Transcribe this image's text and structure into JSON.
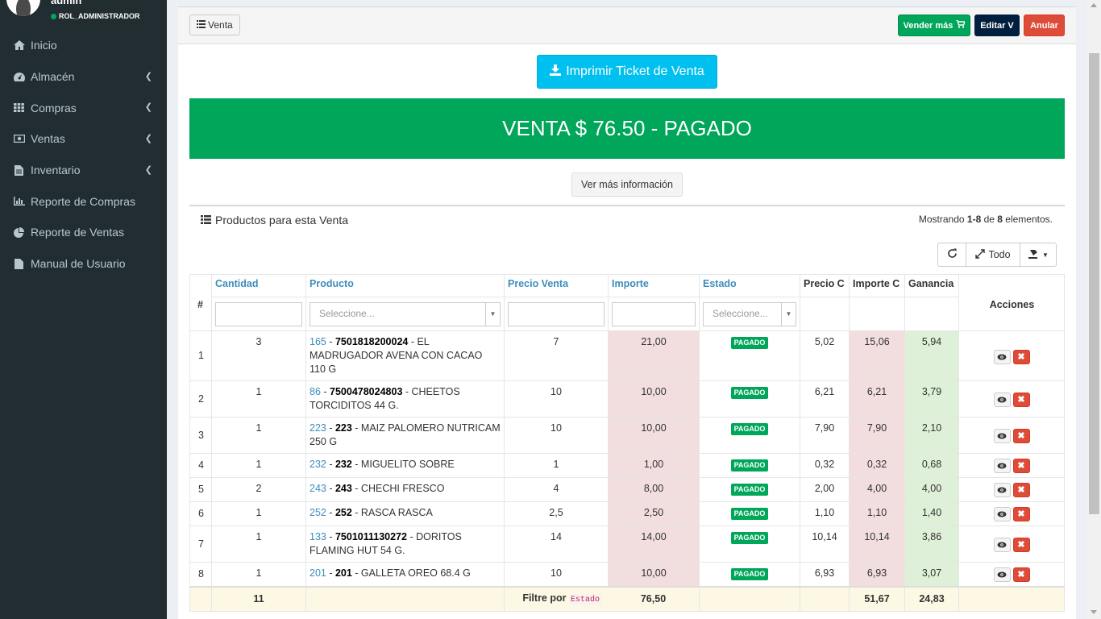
{
  "user": {
    "name": "admin",
    "role": "ROL_ADMINISTRADOR"
  },
  "sidebar": {
    "items": [
      {
        "label": "Inicio",
        "icon": "home-icon",
        "has_children": false
      },
      {
        "label": "Almacén",
        "icon": "dashboard-icon",
        "has_children": true
      },
      {
        "label": "Compras",
        "icon": "grid-icon",
        "has_children": true
      },
      {
        "label": "Ventas",
        "icon": "money-icon",
        "has_children": true
      },
      {
        "label": "Inventario",
        "icon": "file-icon",
        "has_children": true
      },
      {
        "label": "Reporte de Compras",
        "icon": "bar-chart-icon",
        "has_children": false
      },
      {
        "label": "Reporte de Ventas",
        "icon": "pie-chart-icon",
        "has_children": false
      },
      {
        "label": "Manual de Usuario",
        "icon": "file-icon",
        "has_children": false
      }
    ]
  },
  "header": {
    "venta_label": "Venta",
    "vender_label": "Vender más",
    "editar_label": "Editar V",
    "anular_label": "Anular"
  },
  "print_button": "Imprimir Ticket de Venta",
  "banner": "VENTA $ 76.50 - PAGADO",
  "more_info": "Ver más información",
  "products": {
    "title": "Productos para esta Venta",
    "summary": {
      "prefix": "Mostrando ",
      "range": "1-8",
      "mid": " de ",
      "total": "8",
      "suffix": " elementos."
    },
    "toolbar": {
      "all_label": "Todo"
    },
    "columns": {
      "idx": "#",
      "cantidad": "Cantidad",
      "producto": "Producto",
      "precio_venta": "Precio Venta",
      "importe": "Importe",
      "estado": "Estado",
      "precio_c": "Precio C",
      "importe_c": "Importe C",
      "ganancia": "Ganancia",
      "acciones": "Acciones"
    },
    "filters": {
      "select_placeholder": "Seleccione..."
    },
    "rows": [
      {
        "idx": "1",
        "cantidad": "3",
        "id": "165",
        "code": "7501818200024",
        "name": " - EL MADRUGADOR AVENA CON CACAO 110 G",
        "precio": "7",
        "importe": "21,00",
        "estado": "PAGADO",
        "precio_c": "5,02",
        "importe_c": "15,06",
        "ganancia": "5,94"
      },
      {
        "idx": "2",
        "cantidad": "1",
        "id": "86",
        "code": "7500478024803",
        "name": " - CHEETOS TORCIDITOS 44 G.",
        "precio": "10",
        "importe": "10,00",
        "estado": "PAGADO",
        "precio_c": "6,21",
        "importe_c": "6,21",
        "ganancia": "3,79"
      },
      {
        "idx": "3",
        "cantidad": "1",
        "id": "223",
        "code": "223",
        "name": " - MAIZ PALOMERO NUTRICAM 250 G",
        "precio": "10",
        "importe": "10,00",
        "estado": "PAGADO",
        "precio_c": "7,90",
        "importe_c": "7,90",
        "ganancia": "2,10"
      },
      {
        "idx": "4",
        "cantidad": "1",
        "id": "232",
        "code": "232",
        "name": " - MIGUELITO SOBRE",
        "precio": "1",
        "importe": "1,00",
        "estado": "PAGADO",
        "precio_c": "0,32",
        "importe_c": "0,32",
        "ganancia": "0,68"
      },
      {
        "idx": "5",
        "cantidad": "2",
        "id": "243",
        "code": "243",
        "name": " - CHECHI FRESCO",
        "precio": "4",
        "importe": "8,00",
        "estado": "PAGADO",
        "precio_c": "2,00",
        "importe_c": "4,00",
        "ganancia": "4,00"
      },
      {
        "idx": "6",
        "cantidad": "1",
        "id": "252",
        "code": "252",
        "name": " - RASCA RASCA",
        "precio": "2,5",
        "importe": "2,50",
        "estado": "PAGADO",
        "precio_c": "1,10",
        "importe_c": "1,10",
        "ganancia": "1,40"
      },
      {
        "idx": "7",
        "cantidad": "1",
        "id": "133",
        "code": "7501011130272",
        "name": " - DORITOS FLAMING HUT 54 G.",
        "precio": "14",
        "importe": "14,00",
        "estado": "PAGADO",
        "precio_c": "10,14",
        "importe_c": "10,14",
        "ganancia": "3,86"
      },
      {
        "idx": "8",
        "cantidad": "1",
        "id": "201",
        "code": "201",
        "name": " - GALLETA OREO 68.4 G",
        "precio": "10",
        "importe": "10,00",
        "estado": "PAGADO",
        "precio_c": "6,93",
        "importe_c": "6,93",
        "ganancia": "3,07"
      }
    ],
    "footer": {
      "cantidad": "11",
      "filtre_label": "Filtre por",
      "filtre_code": "Estado",
      "importe": "76,50",
      "importe_c": "51,67",
      "ganancia": "24,83"
    }
  },
  "colors": {
    "sidebar_bg": "#222d32",
    "success": "#00a65a",
    "info": "#00c0ef",
    "danger": "#dd4b39",
    "navy": "#001f3f",
    "link": "#3c8dbc"
  }
}
